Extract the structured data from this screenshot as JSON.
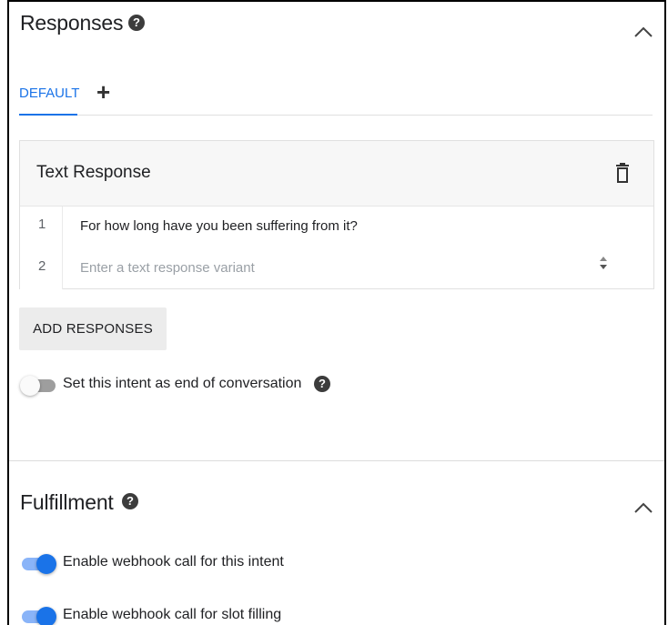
{
  "responses": {
    "title": "Responses",
    "help_icon": "help-circle-icon",
    "collapse_icon": "chevron-up-icon",
    "tabs": [
      {
        "label": "DEFAULT",
        "active": true
      }
    ],
    "add_tab_icon": "plus-icon",
    "text_response": {
      "title": "Text Response",
      "delete_icon": "trash-icon",
      "rows": [
        {
          "number": "1",
          "text": "For how long have you been suffering from it?"
        },
        {
          "number": "2",
          "placeholder": "Enter a text response variant"
        }
      ]
    },
    "add_button_label": "ADD RESPONSES",
    "end_conversation": {
      "label": "Set this intent as end of conversation",
      "enabled": false
    }
  },
  "fulfillment": {
    "title": "Fulfillment",
    "help_icon": "help-circle-icon",
    "collapse_icon": "chevron-up-icon",
    "webhook_intent": {
      "label": "Enable webhook call for this intent",
      "enabled": true
    },
    "webhook_slot": {
      "label": "Enable webhook call for slot filling",
      "enabled": true
    }
  },
  "colors": {
    "accent": "#1a73e8",
    "toggle_on_track": "#8ab4f8",
    "toggle_off_track": "#9e9e9e"
  }
}
